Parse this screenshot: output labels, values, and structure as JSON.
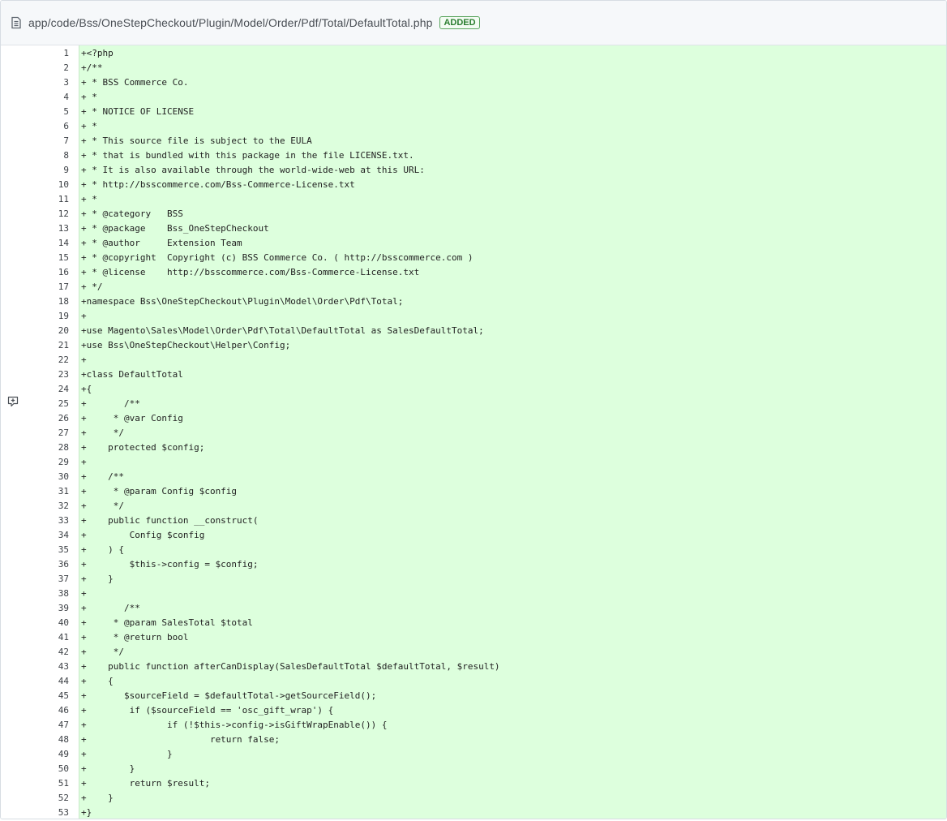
{
  "file": {
    "path": "app/code/Bss/OneStepCheckout/Plugin/Model/Order/Pdf/Total/DefaultTotal.php",
    "status_badge": "ADDED",
    "icon": "file-icon"
  },
  "comment_button": {
    "icon": "add-comment-icon"
  },
  "lines": [
    {
      "n": "1",
      "t": "+<?php"
    },
    {
      "n": "2",
      "t": "+/**"
    },
    {
      "n": "3",
      "t": "+ * BSS Commerce Co."
    },
    {
      "n": "4",
      "t": "+ *"
    },
    {
      "n": "5",
      "t": "+ * NOTICE OF LICENSE"
    },
    {
      "n": "6",
      "t": "+ *"
    },
    {
      "n": "7",
      "t": "+ * This source file is subject to the EULA"
    },
    {
      "n": "8",
      "t": "+ * that is bundled with this package in the file LICENSE.txt."
    },
    {
      "n": "9",
      "t": "+ * It is also available through the world-wide-web at this URL:"
    },
    {
      "n": "10",
      "t": "+ * http://bsscommerce.com/Bss-Commerce-License.txt"
    },
    {
      "n": "11",
      "t": "+ *"
    },
    {
      "n": "12",
      "t": "+ * @category   BSS"
    },
    {
      "n": "13",
      "t": "+ * @package    Bss_OneStepCheckout"
    },
    {
      "n": "14",
      "t": "+ * @author     Extension Team"
    },
    {
      "n": "15",
      "t": "+ * @copyright  Copyright (c) BSS Commerce Co. ( http://bsscommerce.com )"
    },
    {
      "n": "16",
      "t": "+ * @license    http://bsscommerce.com/Bss-Commerce-License.txt"
    },
    {
      "n": "17",
      "t": "+ */"
    },
    {
      "n": "18",
      "t": "+namespace Bss\\OneStepCheckout\\Plugin\\Model\\Order\\Pdf\\Total;"
    },
    {
      "n": "19",
      "t": "+"
    },
    {
      "n": "20",
      "t": "+use Magento\\Sales\\Model\\Order\\Pdf\\Total\\DefaultTotal as SalesDefaultTotal;"
    },
    {
      "n": "21",
      "t": "+use Bss\\OneStepCheckout\\Helper\\Config;"
    },
    {
      "n": "22",
      "t": "+"
    },
    {
      "n": "23",
      "t": "+class DefaultTotal"
    },
    {
      "n": "24",
      "t": "+{"
    },
    {
      "n": "25",
      "t": "+       /**"
    },
    {
      "n": "26",
      "t": "+     * @var Config"
    },
    {
      "n": "27",
      "t": "+     */"
    },
    {
      "n": "28",
      "t": "+    protected $config;"
    },
    {
      "n": "29",
      "t": "+"
    },
    {
      "n": "30",
      "t": "+    /**"
    },
    {
      "n": "31",
      "t": "+     * @param Config $config"
    },
    {
      "n": "32",
      "t": "+     */"
    },
    {
      "n": "33",
      "t": "+    public function __construct("
    },
    {
      "n": "34",
      "t": "+        Config $config"
    },
    {
      "n": "35",
      "t": "+    ) {"
    },
    {
      "n": "36",
      "t": "+        $this->config = $config;"
    },
    {
      "n": "37",
      "t": "+    }"
    },
    {
      "n": "38",
      "t": "+"
    },
    {
      "n": "39",
      "t": "+       /**"
    },
    {
      "n": "40",
      "t": "+     * @param SalesTotal $total"
    },
    {
      "n": "41",
      "t": "+     * @return bool"
    },
    {
      "n": "42",
      "t": "+     */"
    },
    {
      "n": "43",
      "t": "+    public function afterCanDisplay(SalesDefaultTotal $defaultTotal, $result)"
    },
    {
      "n": "44",
      "t": "+    {"
    },
    {
      "n": "45",
      "t": "+       $sourceField = $defaultTotal->getSourceField();"
    },
    {
      "n": "46",
      "t": "+        if ($sourceField == 'osc_gift_wrap') {"
    },
    {
      "n": "47",
      "t": "+               if (!$this->config->isGiftWrapEnable()) {"
    },
    {
      "n": "48",
      "t": "+                       return false;"
    },
    {
      "n": "49",
      "t": "+               }"
    },
    {
      "n": "50",
      "t": "+        }"
    },
    {
      "n": "51",
      "t": "+        return $result;"
    },
    {
      "n": "52",
      "t": "+    }"
    },
    {
      "n": "53",
      "t": "+}"
    }
  ]
}
